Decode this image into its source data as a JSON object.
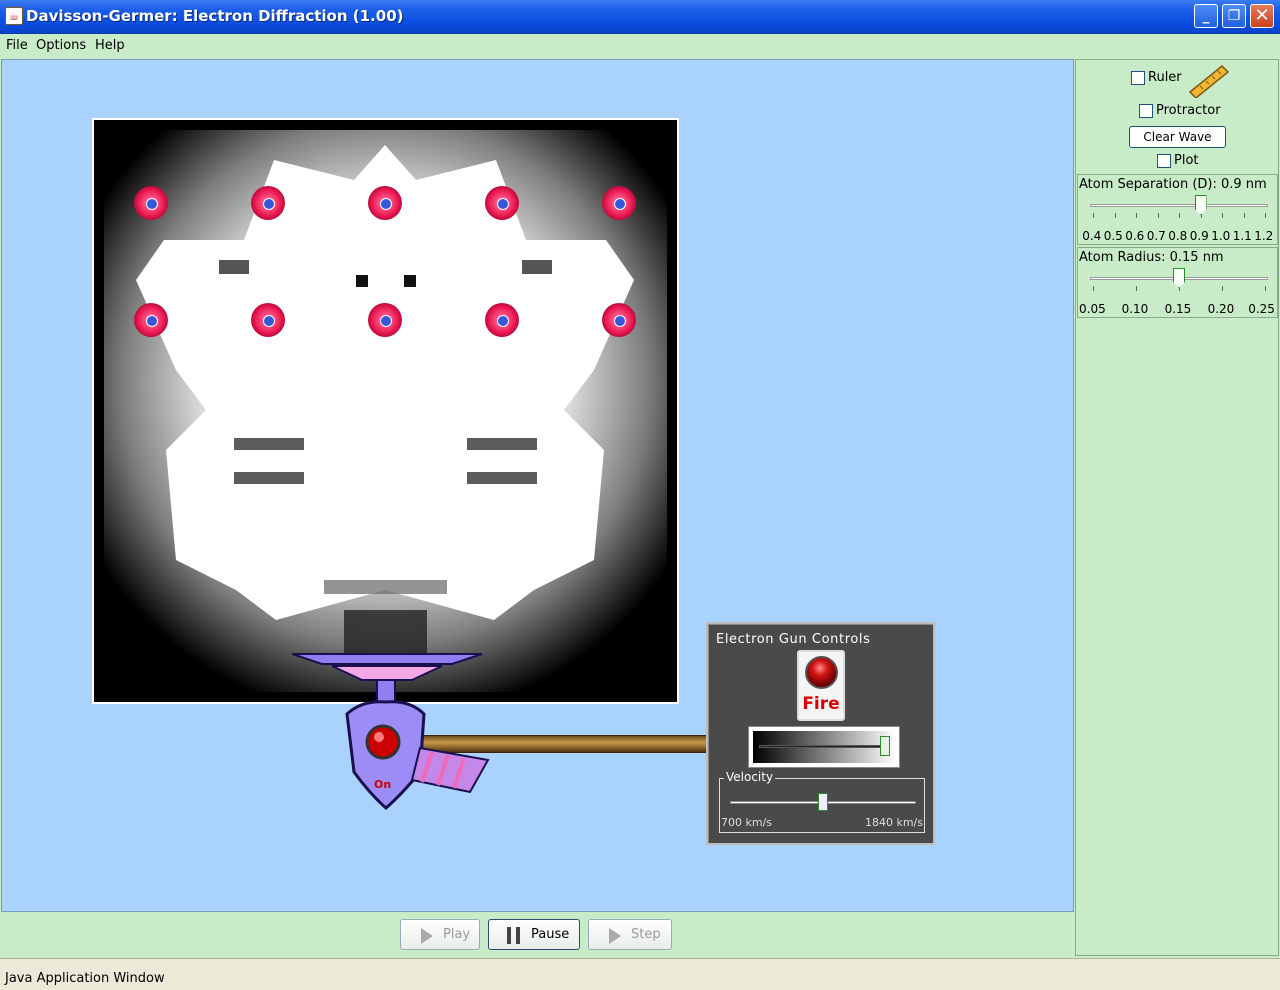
{
  "window": {
    "title": "Davisson-Germer: Electron Diffraction (1.00)",
    "minimize_icon": "minimize-icon",
    "maximize_icon": "maximize-icon",
    "close_icon": "close-icon"
  },
  "menu": {
    "file": "File",
    "options": "Options",
    "help": "Help"
  },
  "controls": {
    "ruler_label": "Ruler",
    "ruler_checked": false,
    "protractor_label": "Protractor",
    "protractor_checked": false,
    "clear_wave_label": "Clear Wave",
    "plot_label": "Plot",
    "plot_checked": false,
    "atom_separation": {
      "title": "Atom Separation (D):  0.9 nm",
      "value": 0.9,
      "ticks": [
        "0.4",
        "0.5",
        "0.6",
        "0.7",
        "0.8",
        "0.9",
        "1.0",
        "1.1",
        "1.2"
      ]
    },
    "atom_radius": {
      "title": "Atom Radius:  0.15 nm",
      "value": 0.15,
      "ticks": [
        "0.05",
        "0.10",
        "0.15",
        "0.20",
        "0.25"
      ]
    }
  },
  "gun_controls": {
    "title": "Electron Gun Controls",
    "fire_label": "Fire",
    "gun_on_label": "On",
    "intensity_fraction": 1.0,
    "velocity_title": "Velocity",
    "velocity_min": "700 km/s",
    "velocity_max": "1840 km/s",
    "velocity_fraction": 0.5
  },
  "transport": {
    "play": "Play",
    "pause": "Pause",
    "step": "Step"
  },
  "status": "Java Application Window",
  "colors": {
    "canvas_bg": "#a9d3fc",
    "panel_bg": "#c8ebc8",
    "atom": "#e8184f",
    "gun": "#8f7ff0"
  }
}
